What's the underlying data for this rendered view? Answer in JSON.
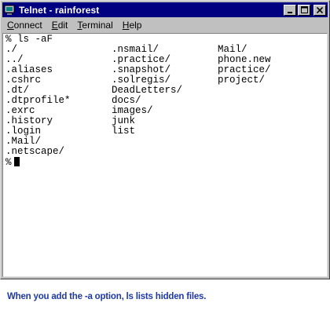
{
  "window": {
    "title": "Telnet - rainforest",
    "minimize_glyph": "_",
    "maximize_glyph": "□",
    "close_glyph": "✕"
  },
  "menu": {
    "items": [
      {
        "label": "Connect",
        "accel": "C",
        "rest": "onnect"
      },
      {
        "label": "Edit",
        "accel": "E",
        "rest": "dit"
      },
      {
        "label": "Terminal",
        "accel": "T",
        "rest": "erminal"
      },
      {
        "label": "Help",
        "accel": "H",
        "rest": "elp"
      }
    ]
  },
  "terminal": {
    "command_line": "% ls -aF",
    "rows": [
      [
        "./",
        ".nsmail/",
        "Mail/"
      ],
      [
        "../",
        ".practice/",
        "phone.new"
      ],
      [
        ".aliases",
        ".snapshot/",
        "practice/"
      ],
      [
        ".cshrc",
        ".solregis/",
        "project/"
      ],
      [
        ".dt/",
        "DeadLetters/",
        ""
      ],
      [
        ".dtprofile*",
        "docs/",
        ""
      ],
      [
        ".exrc",
        "images/",
        ""
      ],
      [
        ".history",
        "junk",
        ""
      ],
      [
        ".login",
        "list",
        ""
      ],
      [
        ".Mail/",
        "",
        ""
      ],
      [
        ".netscape/",
        "",
        ""
      ]
    ],
    "prompt": "%"
  },
  "caption": "When you add the -a option, ls lists hidden files."
}
